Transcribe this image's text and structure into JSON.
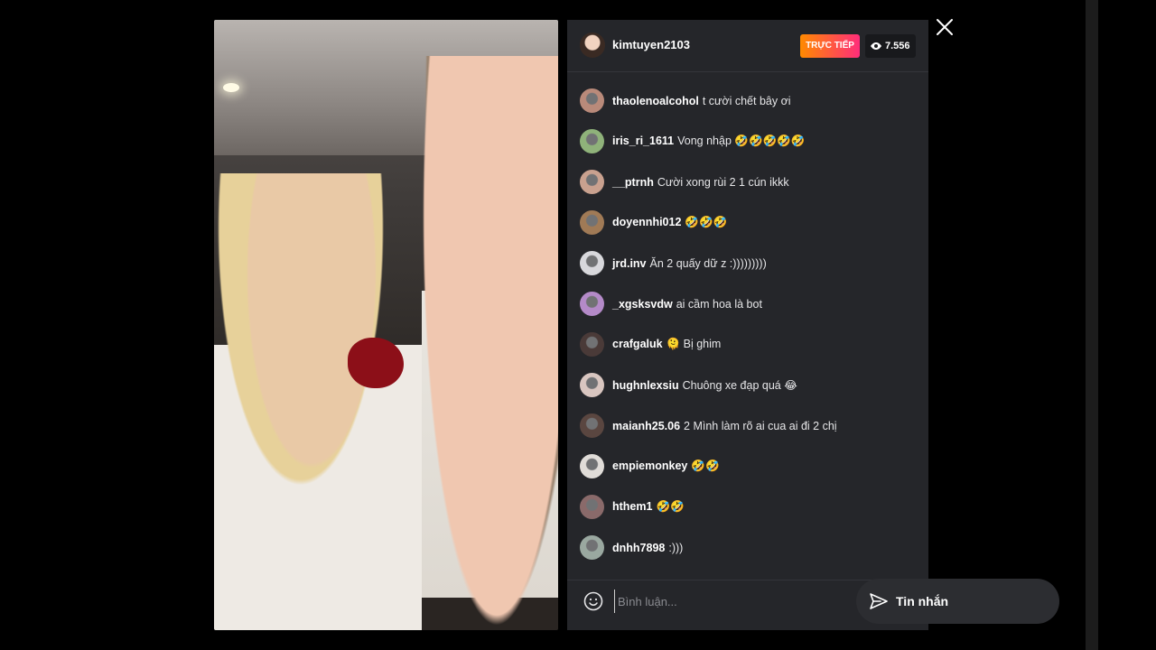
{
  "host": {
    "username": "kimtuyen2103",
    "live_label": "TRỰC TIẾP",
    "viewer_count": "7.556"
  },
  "comments": [
    {
      "user": "thaolenoalcohol",
      "message": "t cười chết bây ơi",
      "avatar_color": "#b98a7a"
    },
    {
      "user": "iris_ri_1611",
      "message": "Vong nhập 🤣🤣🤣🤣🤣",
      "avatar_color": "#8fb27a"
    },
    {
      "user": "__ptrnh",
      "message": "Cười xong rùi 2 1 cún ikkk",
      "avatar_color": "#c9a18f"
    },
    {
      "user": "doyennhi012",
      "message": "🤣🤣🤣",
      "avatar_color": "#a07a56"
    },
    {
      "user": "jrd.inv",
      "message": "Ăn 2 quấy dữ z :)))))))))",
      "avatar_color": "#d8d8dc"
    },
    {
      "user": "_xgsksvdw",
      "message": "ai cầm hoa là bot",
      "avatar_color": "#b48ac8"
    },
    {
      "user": "crafgaluk",
      "message": "🫠 Bị ghim",
      "avatar_color": "#4a3a38"
    },
    {
      "user": "hughnlexsiu",
      "message": "Chuông xe đạp quá 😂",
      "avatar_color": "#d9c6c0"
    },
    {
      "user": "maianh25.06",
      "message": "2 Mình làm rõ ai cua ai đi 2 chị",
      "avatar_color": "#5a4640"
    },
    {
      "user": "empiemonkey",
      "message": "🤣🤣",
      "avatar_color": "#e0dcd8"
    },
    {
      "user": "hthem1",
      "message": "🤣🤣",
      "avatar_color": "#8a6a6a"
    },
    {
      "user": "dnhh7898",
      "message": ":)))",
      "avatar_color": "#9aa8a0"
    }
  ],
  "input": {
    "placeholder": "Bình luận..."
  },
  "message_button": {
    "label": "Tin nhắn"
  },
  "icons": {
    "close": "close-icon",
    "eye": "eye-icon",
    "smile": "smile-icon",
    "send": "send-icon"
  }
}
